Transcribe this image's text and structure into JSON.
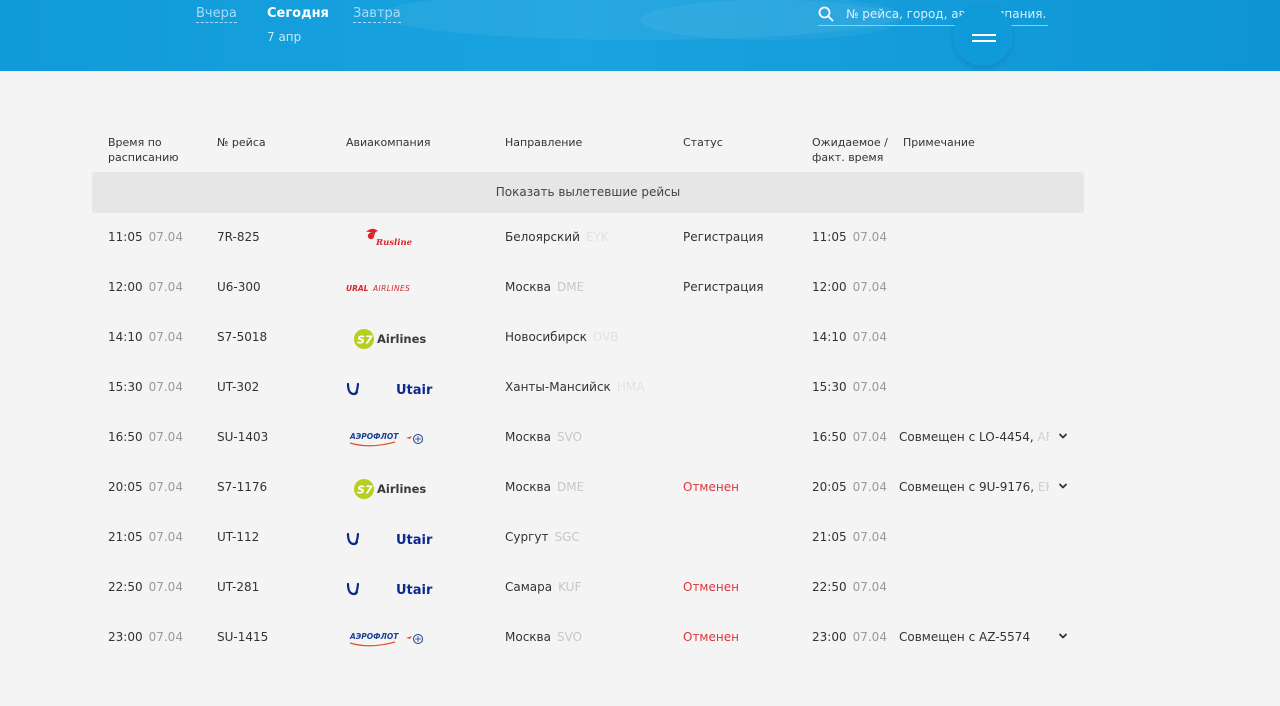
{
  "header": {
    "tabs": [
      "Вчера",
      "Сегодня",
      "Завтра"
    ],
    "active_date": "7 апр",
    "search_placeholder": "№ рейса, город, авиакомпания..."
  },
  "columns": {
    "scheduled": "Время по расписанию",
    "flight": "№ рейса",
    "airline": "Авиакомпания",
    "direction": "Направление",
    "status": "Статус",
    "expected": "Ожидаемое / факт. время",
    "note": "Примечание"
  },
  "show_departed": "Показать вылетевшие рейсы",
  "logos": {
    "rusline": "Rusline",
    "ural": "URAL AIRLINES",
    "s7": "Airlines",
    "utair": "Utair",
    "aeroflot": "АЭРОФЛОТ"
  },
  "flights": [
    {
      "time": "11:05",
      "date": "07.04",
      "flight": "7R-825",
      "airline": "rusline",
      "city": "Белоярский",
      "code": "EYK",
      "status": "Регистрация",
      "exp_time": "11:05",
      "exp_date": "07.04",
      "note": "",
      "note_faded": ""
    },
    {
      "time": "12:00",
      "date": "07.04",
      "flight": "U6-300",
      "airline": "ural",
      "city": "Москва",
      "code": "DME",
      "status": "Регистрация",
      "exp_time": "12:00",
      "exp_date": "07.04",
      "note": "",
      "note_faded": ""
    },
    {
      "time": "14:10",
      "date": "07.04",
      "flight": "S7-5018",
      "airline": "s7",
      "city": "Новосибирск",
      "code": "OVB",
      "status": "",
      "exp_time": "14:10",
      "exp_date": "07.04",
      "note": "",
      "note_faded": ""
    },
    {
      "time": "15:30",
      "date": "07.04",
      "flight": "UT-302",
      "airline": "utair",
      "city": "Ханты-Мансийск",
      "code": "HMA",
      "status": "",
      "exp_time": "15:30",
      "exp_date": "07.04",
      "note": "",
      "note_faded": ""
    },
    {
      "time": "16:50",
      "date": "07.04",
      "flight": "SU-1403",
      "airline": "aeroflot",
      "city": "Москва",
      "code": "SVO",
      "status": "",
      "exp_time": "16:50",
      "exp_date": "07.04",
      "note": "Совмещен с LO-4454, ",
      "note_faded": "AF"
    },
    {
      "time": "20:05",
      "date": "07.04",
      "flight": "S7-1176",
      "airline": "s7",
      "city": "Москва",
      "code": "DME",
      "status": "Отменен",
      "exp_time": "20:05",
      "exp_date": "07.04",
      "note": "Совмещен с 9U-9176, ",
      "note_faded": "EK"
    },
    {
      "time": "21:05",
      "date": "07.04",
      "flight": "UT-112",
      "airline": "utair",
      "city": "Сургут",
      "code": "SGC",
      "status": "",
      "exp_time": "21:05",
      "exp_date": "07.04",
      "note": "",
      "note_faded": ""
    },
    {
      "time": "22:50",
      "date": "07.04",
      "flight": "UT-281",
      "airline": "utair",
      "city": "Самара",
      "code": "KUF",
      "status": "Отменен",
      "exp_time": "22:50",
      "exp_date": "07.04",
      "note": "",
      "note_faded": ""
    },
    {
      "time": "23:00",
      "date": "07.04",
      "flight": "SU-1415",
      "airline": "aeroflot",
      "city": "Москва",
      "code": "SVO",
      "status": "Отменен",
      "exp_time": "23:00",
      "exp_date": "07.04",
      "note": "Совмещен с AZ-5574",
      "note_faded": ""
    }
  ]
}
